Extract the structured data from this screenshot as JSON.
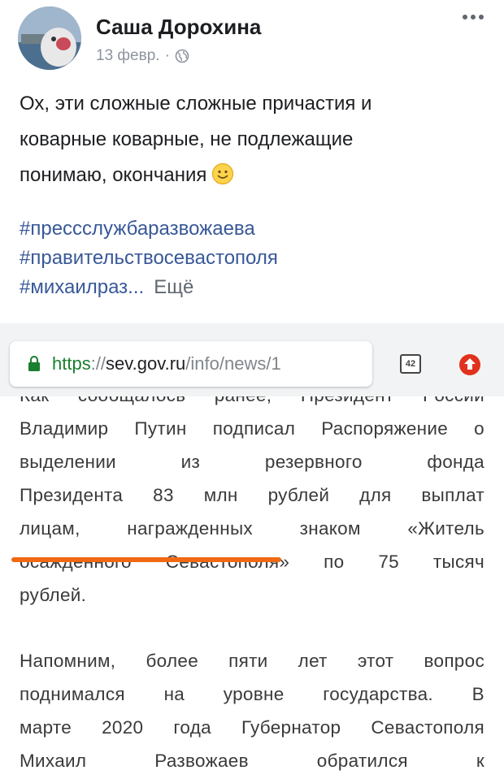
{
  "post": {
    "author": "Саша Дорохина",
    "date": "13 февр.",
    "separator": "·",
    "privacy_icon": "globe-icon",
    "text_lines": [
      "Ох, эти сложные сложные причастия и",
      "коварные коварные, не подлежащие",
      "понимаю, окончания"
    ],
    "emoji": "slightly-smiling-face-icon",
    "hashtags": [
      "#прессслужбаразвожаева",
      "#правительствосевастополя",
      "#михаилраз..."
    ],
    "see_more": "Ещё"
  },
  "browser": {
    "url_protocol": "https",
    "url_separator": "://",
    "url_domain": "sev.gov.ru",
    "url_path": "/info/news/1",
    "tabs_count": "42"
  },
  "article": {
    "para1_lines": [
      "Как сообщалось ранее, Президент России",
      "Владимир Путин подписал Распоряжение о",
      "выделении из резервного фонда",
      "Президента 83 млн рублей для выплат",
      "лицам, награжденных знаком «Житель",
      "осажденного Севастополя» по 75 тысяч",
      "рублей."
    ],
    "para2_lines": [
      "Напомним, более пяти лет этот вопрос",
      "поднимался на уровне государства. В",
      "марте 2020 года Губернатор Севастополя",
      "Михаил Развожаев обратился к"
    ]
  },
  "colors": {
    "link": "#385898",
    "underline_mark": "#f06a14",
    "secure": "#1a7f2e",
    "upload": "#e0321c"
  }
}
